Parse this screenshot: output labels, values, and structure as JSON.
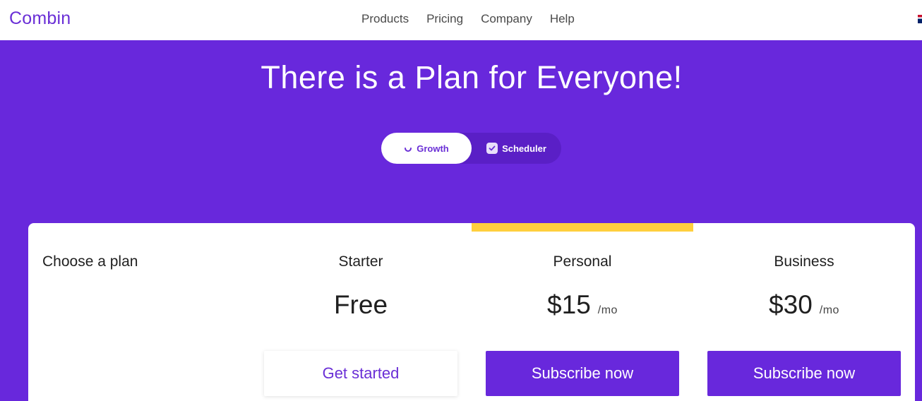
{
  "header": {
    "logo_text": "Combin",
    "nav": [
      "Products",
      "Pricing",
      "Company",
      "Help"
    ]
  },
  "hero": {
    "title": "There is a Plan for Everyone!"
  },
  "toggle": {
    "options": [
      "Growth",
      "Scheduler"
    ],
    "selected": "Growth"
  },
  "pricing": {
    "choose_label": "Choose a plan",
    "highlighted_plan": "Personal",
    "plans": [
      {
        "name": "Starter",
        "price": "Free",
        "period": "",
        "button": "Get started"
      },
      {
        "name": "Personal",
        "price": "$15",
        "period": "/mo",
        "button": "Subscribe now"
      },
      {
        "name": "Business",
        "price": "$30",
        "period": "/mo",
        "button": "Subscribe now"
      }
    ]
  },
  "colors": {
    "brand": "#6828dc",
    "highlight": "#ffcf3e"
  }
}
